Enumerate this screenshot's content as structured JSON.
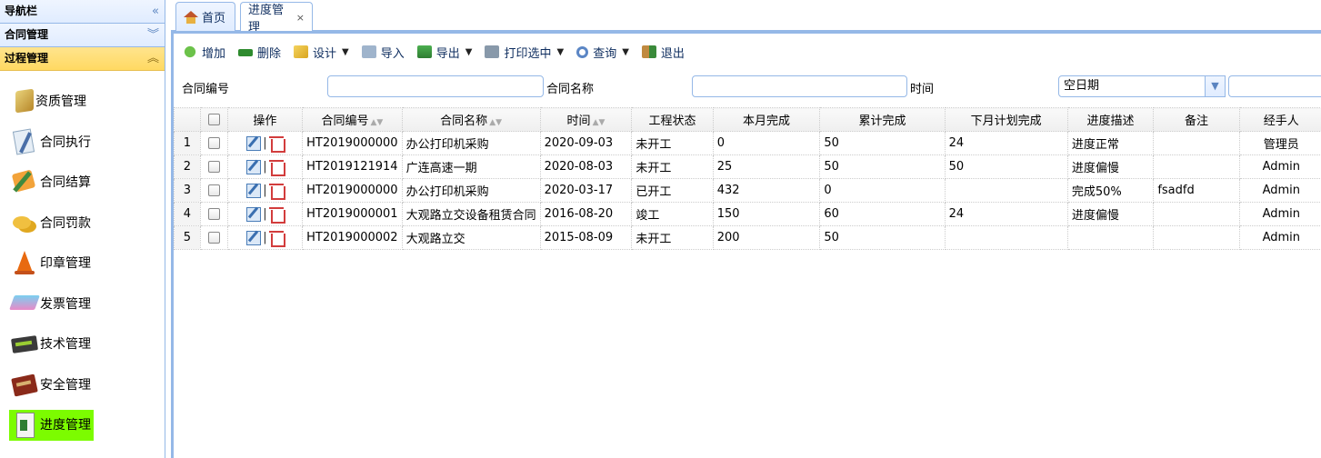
{
  "sidebar": {
    "title": "导航栏",
    "title_tool": "«",
    "sections": [
      {
        "label": "合同管理",
        "tool": "︾"
      },
      {
        "label": "过程管理",
        "tool": "︽"
      }
    ],
    "items": [
      {
        "label": "资质管理",
        "icon": "certificate-icon"
      },
      {
        "label": "合同执行",
        "icon": "contract-pen-icon"
      },
      {
        "label": "合同结算",
        "icon": "settlement-icon"
      },
      {
        "label": "合同罚款",
        "icon": "coins-icon"
      },
      {
        "label": "印章管理",
        "icon": "seal-cone-icon"
      },
      {
        "label": "发票管理",
        "icon": "invoice-stack-icon"
      },
      {
        "label": "技术管理",
        "icon": "tech-device-icon"
      },
      {
        "label": "安全管理",
        "icon": "safety-book-icon"
      },
      {
        "label": "进度管理",
        "icon": "progress-doc-icon"
      }
    ],
    "active_color": "#7cfc00"
  },
  "tabs": [
    {
      "label": "首页",
      "icon": "home-icon"
    },
    {
      "label": "进度管理",
      "close": "×"
    }
  ],
  "toolbar": {
    "add": "增加",
    "delete": "删除",
    "design": "设计",
    "import": "导入",
    "export": "导出",
    "print": "打印选中",
    "query": "查询",
    "exit": "退出"
  },
  "search": {
    "contract_no_label": "合同编号",
    "contract_no_value": "",
    "contract_name_label": "合同名称",
    "contract_name_value": "",
    "time_label": "时间",
    "time_value": "空日期",
    "time_end_value": ""
  },
  "grid": {
    "columns": [
      "操作",
      "合同编号",
      "合同名称",
      "时间",
      "工程状态",
      "本月完成",
      "累计完成",
      "下月计划完成",
      "进度描述",
      "备注",
      "经手人"
    ],
    "rows": [
      {
        "no": "1",
        "contract_no": "HT2019000000",
        "name": "办公打印机采购",
        "time": "2020-09-03",
        "status": "未开工",
        "month": "0",
        "total": "50",
        "next": "24",
        "desc": "进度正常",
        "remark": "",
        "handler": "管理员"
      },
      {
        "no": "2",
        "contract_no": "HT2019121914",
        "name": "广连高速一期",
        "time": "2020-08-03",
        "status": "未开工",
        "month": "25",
        "total": "50",
        "next": "50",
        "desc": "进度偏慢",
        "remark": "",
        "handler": "Admin"
      },
      {
        "no": "3",
        "contract_no": "HT2019000000",
        "name": "办公打印机采购",
        "time": "2020-03-17",
        "status": "已开工",
        "month": "432",
        "total": "0",
        "next": "",
        "desc": "完成50%",
        "remark": "fsadfd",
        "handler": "Admin"
      },
      {
        "no": "4",
        "contract_no": "HT2019000001",
        "name": "大观路立交设备租赁合同",
        "time": "2016-08-20",
        "status": "竣工",
        "month": "150",
        "total": "60",
        "next": "24",
        "desc": "进度偏慢",
        "remark": "",
        "handler": "Admin"
      },
      {
        "no": "5",
        "contract_no": "HT2019000002",
        "name": "大观路立交",
        "time": "2015-08-09",
        "status": "未开工",
        "month": "200",
        "total": "50",
        "next": "",
        "desc": "",
        "remark": "",
        "handler": "Admin"
      }
    ]
  }
}
